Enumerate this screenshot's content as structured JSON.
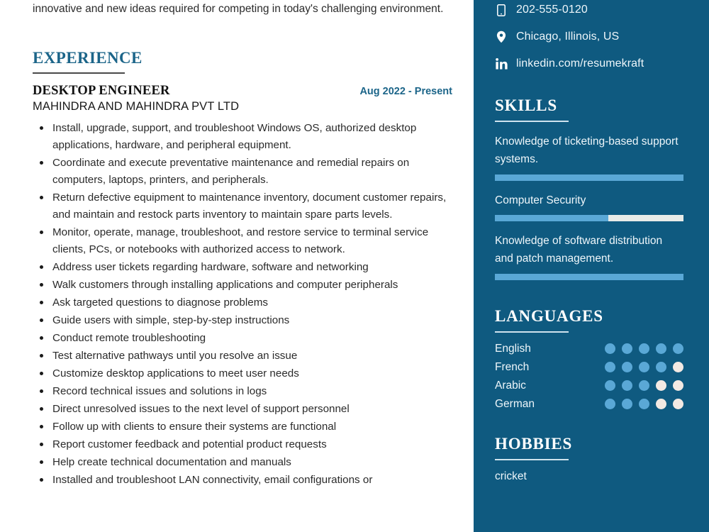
{
  "summary": {
    "tail_text": "innovative and new ideas required for competing in today's challenging environment."
  },
  "experience": {
    "heading": "EXPERIENCE",
    "jobs": [
      {
        "title": "DESKTOP ENGINEER",
        "company": "MAHINDRA AND MAHINDRA PVT LTD",
        "date": "Aug 2022 - Present",
        "duties": [
          "Install, upgrade, support, and troubleshoot Windows OS, authorized desktop applications, hardware, and peripheral equipment.",
          "Coordinate and execute preventative maintenance and remedial repairs on computers, laptops, printers, and peripherals.",
          "Return defective equipment to maintenance inventory, document customer repairs, and maintain and restock parts inventory to maintain spare parts levels.",
          "Monitor, operate, manage, troubleshoot, and restore service to terminal service clients, PCs, or notebooks with authorized access to network.",
          "Address user tickets regarding hardware, software and networking",
          "Walk customers through installing applications and computer peripherals",
          "Ask targeted questions to diagnose problems",
          "Guide users with simple, step-by-step instructions",
          "Conduct remote troubleshooting",
          "Test alternative pathways until you resolve an issue",
          "Customize desktop applications to meet user needs",
          "Record technical issues and solutions in logs",
          "Direct unresolved issues to the next level of support personnel",
          "Follow up with clients to ensure their systems are functional",
          "Report customer feedback and potential product requests",
          "Help create technical documentation and manuals",
          "Installed and troubleshoot LAN connectivity, email configurations or"
        ]
      }
    ]
  },
  "sidebar": {
    "contacts": [
      {
        "icon": "mobile-phone-icon",
        "text": "202-555-0120"
      },
      {
        "icon": "location-pin-icon",
        "text": "Chicago, Illinois, US"
      },
      {
        "icon": "linkedin-icon",
        "text": "linkedin.com/resumekraft"
      }
    ],
    "skills": {
      "heading": "SKILLS",
      "items": [
        {
          "name": "Knowledge of ticketing-based support systems.",
          "level": 100
        },
        {
          "name": "Computer Security",
          "level": 60
        },
        {
          "name": "Knowledge of software distribution and patch management.",
          "level": 100
        }
      ]
    },
    "languages": {
      "heading": "LANGUAGES",
      "max_dots": 5,
      "items": [
        {
          "name": "English",
          "level": 5
        },
        {
          "name": "French",
          "level": 4
        },
        {
          "name": "Arabic",
          "level": 3
        },
        {
          "name": "German",
          "level": 3
        }
      ]
    },
    "hobbies": {
      "heading": "HOBBIES",
      "items": [
        "cricket"
      ]
    }
  },
  "colors": {
    "sidebar_bg": "#0f5a80",
    "accent_blue": "#1c6589",
    "bar_fill": "#5aa8d6",
    "bar_track": "#e8ebe8",
    "dot_off": "#f3e9e3"
  }
}
